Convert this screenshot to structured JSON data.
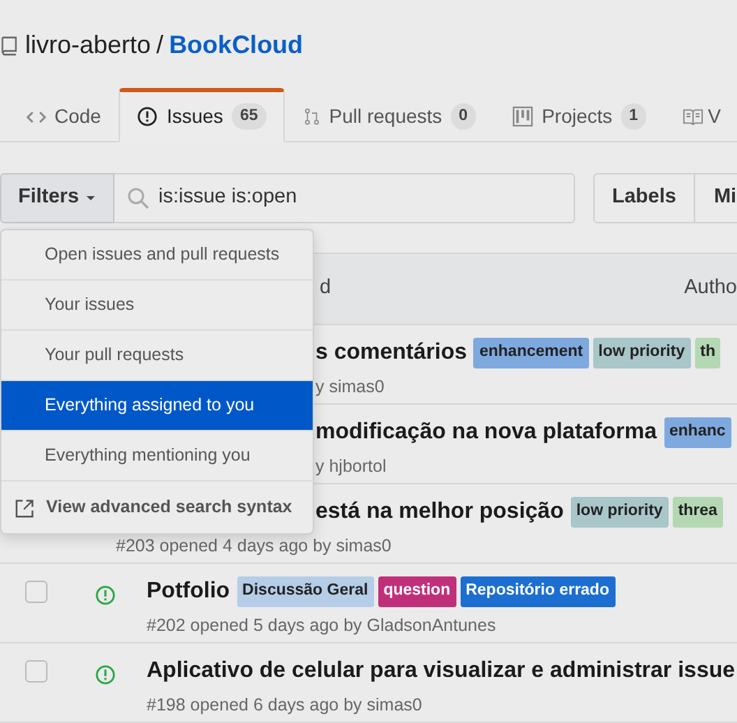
{
  "repo": {
    "owner": "livro-aberto",
    "separator": "/",
    "name": "BookCloud"
  },
  "tabs": [
    {
      "label": "Code",
      "selected": false
    },
    {
      "label": "Issues",
      "count": "65",
      "selected": true
    },
    {
      "label": "Pull requests",
      "count": "0",
      "selected": false
    },
    {
      "label": "Projects",
      "count": "1",
      "selected": false
    },
    {
      "label": "V",
      "selected": false
    }
  ],
  "filter": {
    "button": "Filters",
    "query": "is:issue is:open"
  },
  "buttons": [
    "Labels",
    "Mi"
  ],
  "filter_menu": [
    {
      "label": "Open issues and pull requests",
      "kind": "option",
      "selected": false
    },
    {
      "label": "Your issues",
      "kind": "option",
      "selected": false
    },
    {
      "label": "Your pull requests",
      "kind": "option",
      "selected": false
    },
    {
      "label": "Everything assigned to you",
      "kind": "option",
      "selected": true
    },
    {
      "label": "Everything mentioning you",
      "kind": "option",
      "selected": false
    },
    {
      "label": "View advanced search syntax",
      "kind": "link"
    }
  ],
  "issue_list": {
    "header": [
      "d",
      "Autho"
    ],
    "issues": [
      {
        "kind": "hidden-left",
        "title": "s comentários",
        "meta": "y simas0",
        "labels": [
          {
            "name": "enhancement",
            "color": "#7ea9df"
          },
          {
            "name": "low priority",
            "color": "#a9c6c9"
          },
          {
            "name": "th",
            "color": "#b3d8b3"
          }
        ]
      },
      {
        "kind": "hidden-left",
        "title": "modificação na nova plataforma",
        "meta": "y hjbortol",
        "labels": [
          {
            "name": "enhanc",
            "color": "#7ea9df"
          }
        ]
      },
      {
        "kind": "title-hidden",
        "title": "está na melhor posição",
        "meta": "#203 opened 4 days ago by simas0",
        "labels": [
          {
            "name": "low priority",
            "color": "#a9c6c9"
          },
          {
            "name": "threa",
            "color": "#b3d8b3"
          }
        ]
      },
      {
        "kind": "full",
        "checked": false,
        "title": "Potfolio",
        "meta": "#202 opened 5 days ago by GladsonAntunes",
        "labels": [
          {
            "name": "Discussão Geral",
            "color": "#b5cde6"
          },
          {
            "name": "question",
            "color": "#c0307a"
          },
          {
            "name": "Repositório errado",
            "color": "#1c6ed0"
          }
        ]
      },
      {
        "kind": "full",
        "checked": false,
        "title": "Aplicativo de celular para visualizar e administrar issue",
        "meta": "#198 opened 6 days ago by simas0"
      }
    ]
  }
}
